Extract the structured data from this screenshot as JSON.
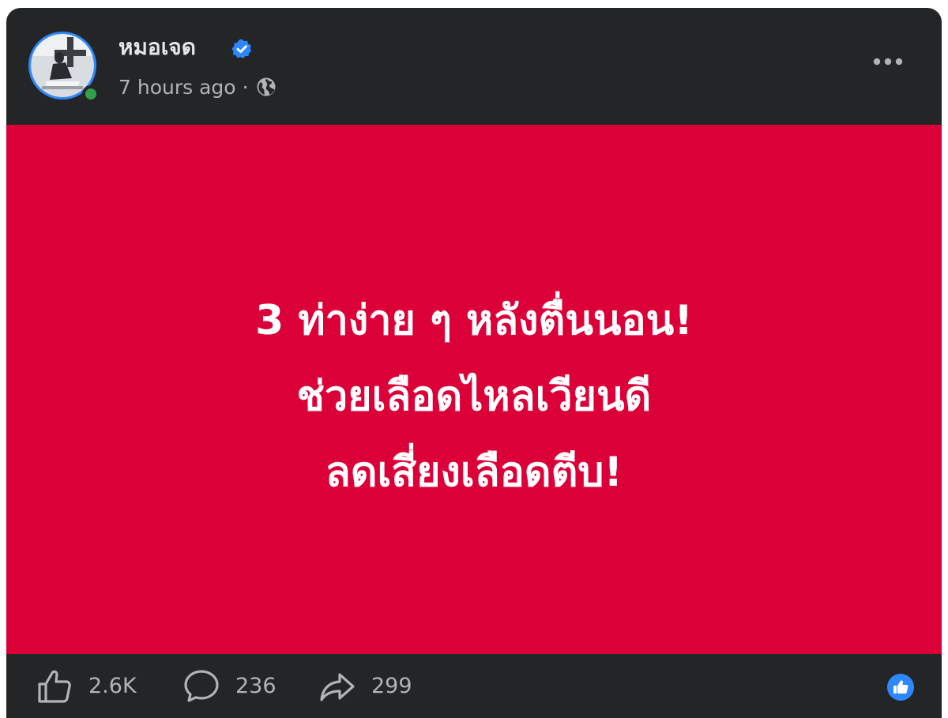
{
  "post": {
    "author_name": "หมอเจด",
    "verified_icon": "verified-badge-icon",
    "timestamp": "7 hours ago",
    "separator": "·",
    "audience_icon": "globe-icon",
    "more_icon": "more-options-icon",
    "online_status_color": "#31a24c"
  },
  "banner": {
    "background_color": "#dc0039",
    "lines": [
      "3 ท่าง่าย ๆ หลังตื่นนอน!",
      "ช่วยเลือดไหลเวียนดี",
      "ลดเสี่ยงเลือดตีบ!"
    ]
  },
  "actions": {
    "likes": {
      "icon": "thumbs-up-icon",
      "count": "2.6K"
    },
    "comments": {
      "icon": "comment-icon",
      "count": "236"
    },
    "shares": {
      "icon": "share-icon",
      "count": "299"
    },
    "reaction_badge_icon": "like-reaction-icon",
    "accent_color": "#2d88ff"
  }
}
